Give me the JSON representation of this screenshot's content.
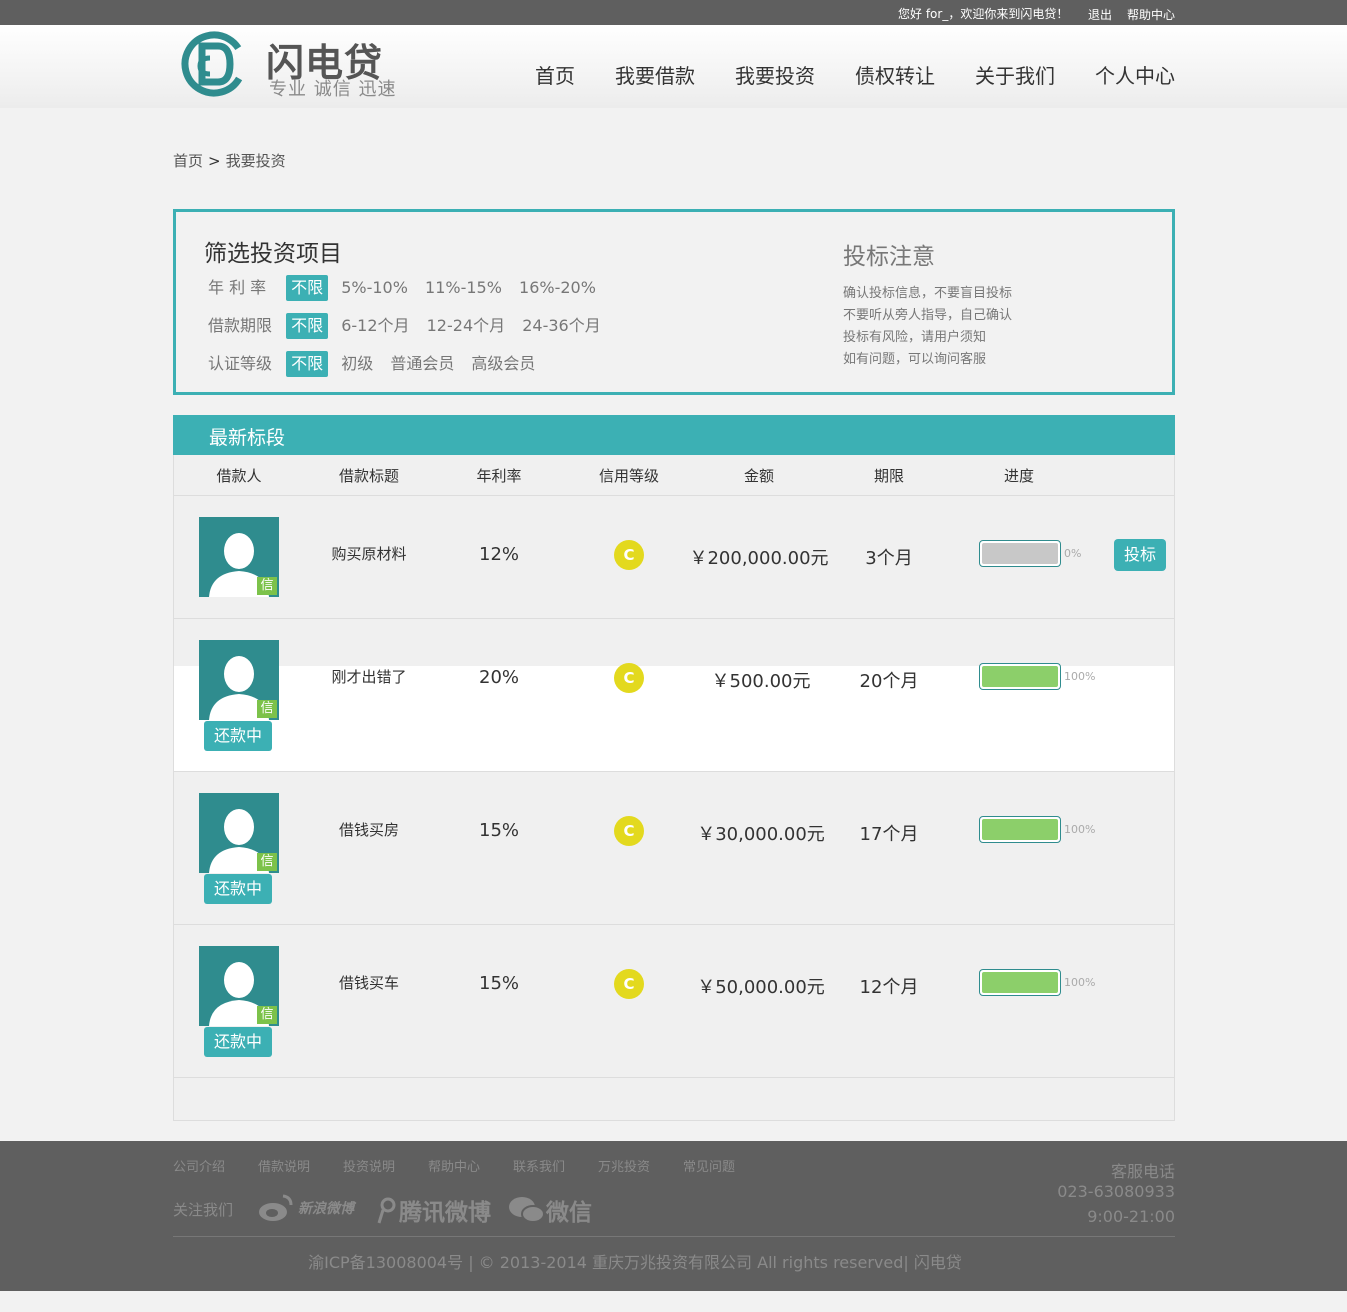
{
  "topbar": {
    "greeting": "您好 for_，欢迎你来到闪电贷！",
    "logout": "退出",
    "help": "帮助中心"
  },
  "logo": {
    "name": "闪电贷",
    "slogan": "专业 诚信 迅速",
    "color": "#2f8c8e"
  },
  "nav": [
    "首页",
    "我要借款",
    "我要投资",
    "债权转让",
    "关于我们",
    "个人中心"
  ],
  "breadcrumb": {
    "home": "首页",
    "separator": ">",
    "current": "我要投资"
  },
  "filter": {
    "title": "筛选投资项目",
    "rows": [
      {
        "label": "年 利 率",
        "options": [
          "不限",
          "5%-10%",
          "11%-15%",
          "16%-20%"
        ],
        "active": 0
      },
      {
        "label": "借款期限",
        "options": [
          "不限",
          "6-12个月",
          "12-24个月",
          "24-36个月"
        ],
        "active": 0
      },
      {
        "label": "认证等级",
        "options": [
          "不限",
          "初级",
          "普通会员",
          "高级会员"
        ],
        "active": 0
      }
    ]
  },
  "notice": {
    "title": "投标注意",
    "lines": [
      "确认投标信息，不要盲目投标",
      "不要听从旁人指导，自己确认",
      "投标有风险，请用户须知",
      "如有问题，可以询问客服"
    ]
  },
  "list": {
    "title": "最新标段",
    "columns": [
      "借款人",
      "借款标题",
      "年利率",
      "信用等级",
      "金额",
      "期限",
      "进度"
    ],
    "rows": [
      {
        "title": "购买原材料",
        "rate": "12%",
        "credit": "C",
        "amount": "￥200,000.00元",
        "term": "3个月",
        "progress": 0,
        "progress_text": "0%",
        "action": "投标",
        "status": "",
        "badge": "信"
      },
      {
        "title": "刚才出错了",
        "rate": "20%",
        "credit": "C",
        "amount": "￥500.00元",
        "term": "20个月",
        "progress": 100,
        "progress_text": "100%",
        "action": "",
        "status": "还款中",
        "badge": "信"
      },
      {
        "title": "借钱买房",
        "rate": "15%",
        "credit": "C",
        "amount": "￥30,000.00元",
        "term": "17个月",
        "progress": 100,
        "progress_text": "100%",
        "action": "",
        "status": "还款中",
        "badge": "信"
      },
      {
        "title": "借钱买车",
        "rate": "15%",
        "credit": "C",
        "amount": "￥50,000.00元",
        "term": "12个月",
        "progress": 100,
        "progress_text": "100%",
        "action": "",
        "status": "还款中",
        "badge": "信"
      }
    ]
  },
  "colors": {
    "accent": "#3cb0b4",
    "credit": "#e3d91e",
    "progress_full": "#8ccf6a",
    "progress_empty": "#c8c8c8"
  },
  "footer": {
    "links": [
      "公司介绍",
      "借款说明",
      "投资说明",
      "帮助中心",
      "联系我们",
      "万兆投资",
      "常见问题"
    ],
    "follow": "关注我们",
    "social": [
      {
        "icon": "weibo-icon",
        "name": "新浪微博"
      },
      {
        "icon": "tencent-weibo-icon",
        "name": "腾讯微博"
      },
      {
        "icon": "wechat-icon",
        "name": "微信"
      }
    ],
    "hotline_label": "客服电话",
    "hotline_number": "023-63080933",
    "hours": "9:00-21:00",
    "copyright": "渝ICP备13008004号 | © 2013-2014 重庆万兆投资有限公司 All rights reserved| 闪电贷"
  }
}
